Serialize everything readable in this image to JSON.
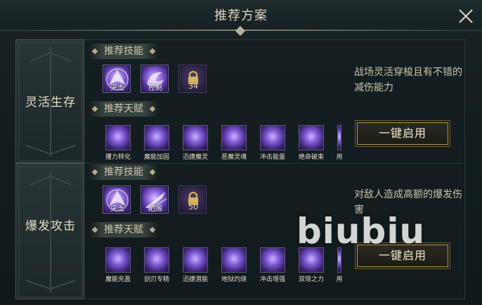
{
  "dialog": {
    "title": "推荐方案",
    "close_icon": "close-icon"
  },
  "plans": [
    {
      "name": "灵活生存",
      "skills_label": "推荐技能",
      "skills": [
        {
          "caption": "突击",
          "icon": "sword-dash-icon",
          "locked": false
        },
        {
          "caption": "控制",
          "icon": "swirl-control-icon",
          "locked": false
        },
        {
          "caption": "34",
          "icon": "lock-icon",
          "locked": true
        }
      ],
      "talents_label": "推荐天赋",
      "talents": [
        {
          "caption": "攫力转化",
          "icon": "rose-plus-icon"
        },
        {
          "caption": "魔能加固",
          "icon": "lotus-shield-icon"
        },
        {
          "caption": "迅捷魔灵",
          "icon": "spark-arrow-icon"
        },
        {
          "caption": "恶魔灵魂",
          "icon": "demon-soul-icon"
        },
        {
          "caption": "冲击能量",
          "icon": "dragon-swirl-icon"
        },
        {
          "caption": "绝命破束",
          "icon": "winged-strike-icon"
        },
        {
          "caption": "用",
          "icon": "talent-icon"
        }
      ],
      "description": "战场灵活穿梭且有不错的减伤能力",
      "enable_label": "一键启用"
    },
    {
      "name": "爆发攻击",
      "skills_label": "推荐技能",
      "skills": [
        {
          "caption": "突击",
          "icon": "sword-dash-icon",
          "locked": false
        },
        {
          "caption": "范围",
          "icon": "slash-area-icon",
          "locked": false
        },
        {
          "caption": "50",
          "icon": "lock-icon",
          "locked": true
        }
      ],
      "talents_label": "推荐天赋",
      "talents": [
        {
          "caption": "魔能充盈",
          "icon": "crossed-swords-icon"
        },
        {
          "caption": "剑刃专精",
          "icon": "blade-icon"
        },
        {
          "caption": "迅捷潜能",
          "icon": "claw-slash-icon"
        },
        {
          "caption": "地狱灼烧",
          "icon": "hell-fire-icon"
        },
        {
          "caption": "冲击增强",
          "icon": "shock-wave-icon"
        },
        {
          "caption": "双增之力",
          "icon": "twin-power-icon"
        },
        {
          "caption": "用",
          "icon": "talent-icon"
        }
      ],
      "description": "对敌人造成高额的爆发伤害",
      "enable_label": "一键启用"
    }
  ],
  "watermark": "biubiu"
}
